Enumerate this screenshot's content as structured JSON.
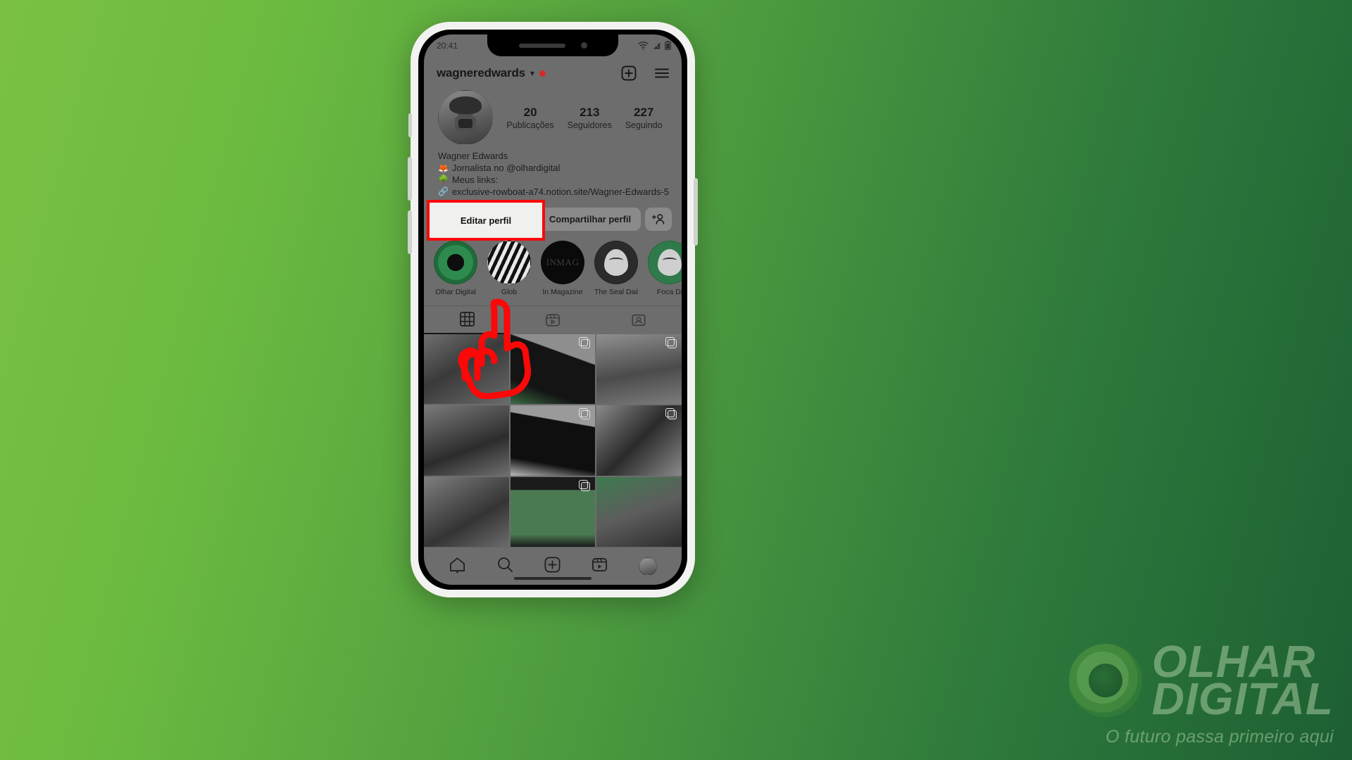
{
  "background": {
    "color_left": "#7ac143",
    "color_right": "#1d5f33"
  },
  "watermark": {
    "brand_line1": "OLHAR",
    "brand_line2": "DIGITAL",
    "tagline": "O futuro passa primeiro aqui"
  },
  "phone": {
    "statusbar": {
      "time": "20:41",
      "wifi": "wifi-off-icon",
      "signal": "signal-icon",
      "battery": "battery-icon"
    },
    "header": {
      "username": "wagneredwards",
      "chevron": "⌄",
      "notification_dot": true,
      "add_icon": "plus-box-icon",
      "menu_icon": "hamburger-menu-icon"
    },
    "profile": {
      "avatar": "profile-avatar",
      "stats": [
        {
          "num": "20",
          "label": "Publicações"
        },
        {
          "num": "213",
          "label": "Seguidores"
        },
        {
          "num": "227",
          "label": "Seguindo"
        }
      ],
      "display_name": "Wagner Edwards",
      "bio_line1": "Jornalista no @olhardigital",
      "bio_line1_emoji": "🦊",
      "bio_line2": "Meus links:",
      "bio_line2_emoji": "🌳",
      "bio_link": "exclusive-rowboat-a74.notion.site/Wagner-Edwards-58…",
      "bio_link_emoji": "🔗"
    },
    "actions": {
      "edit_profile": "Editar perfil",
      "share_profile": "Compartilhar perfil",
      "add_person_icon": "add-person-icon"
    },
    "highlights": [
      {
        "label": "Olhar Digital",
        "cover": "eye-cover"
      },
      {
        "label": "Glob",
        "cover": "stripes-cover"
      },
      {
        "label": "In Magazine",
        "cover": "INMAG"
      },
      {
        "label": "The Seal Daily",
        "cover": "seal-cover"
      },
      {
        "label": "Foca Di",
        "cover": "seal-green-cover"
      }
    ],
    "tabs": [
      {
        "icon": "grid-icon",
        "active": true
      },
      {
        "icon": "reels-icon",
        "active": false
      },
      {
        "icon": "tagged-icon",
        "active": false
      }
    ],
    "grid": [
      {
        "id": "post-1",
        "carousel": false
      },
      {
        "id": "post-2",
        "carousel": true
      },
      {
        "id": "post-3",
        "carousel": true
      },
      {
        "id": "post-4",
        "carousel": false
      },
      {
        "id": "post-5",
        "carousel": true
      },
      {
        "id": "post-6",
        "carousel": true
      },
      {
        "id": "post-7",
        "carousel": false
      },
      {
        "id": "post-8",
        "carousel": true
      },
      {
        "id": "post-9",
        "carousel": false
      }
    ],
    "bottomnav": [
      {
        "icon": "home-icon",
        "active": true
      },
      {
        "icon": "search-icon",
        "active": false
      },
      {
        "icon": "add-icon",
        "active": false
      },
      {
        "icon": "reels-icon",
        "active": false
      },
      {
        "icon": "profile-icon",
        "active": false
      }
    ]
  },
  "annotation": {
    "highlight_target": "Editar perfil",
    "highlight_color": "#fb0808",
    "cursor": "pointing-hand-cursor"
  }
}
